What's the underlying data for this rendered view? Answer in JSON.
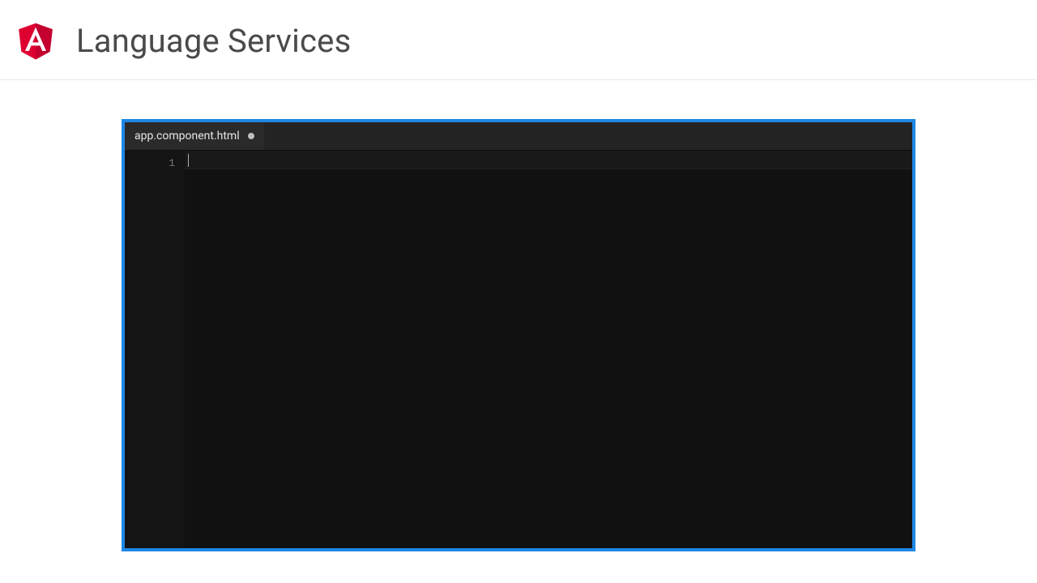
{
  "header": {
    "title": "Language Services",
    "logo_letter": "A"
  },
  "editor": {
    "border_color": "#1e88e5",
    "tab": {
      "filename": "app.component.html",
      "dirty": true
    },
    "gutter": {
      "lines": [
        "1"
      ]
    },
    "content": ""
  }
}
